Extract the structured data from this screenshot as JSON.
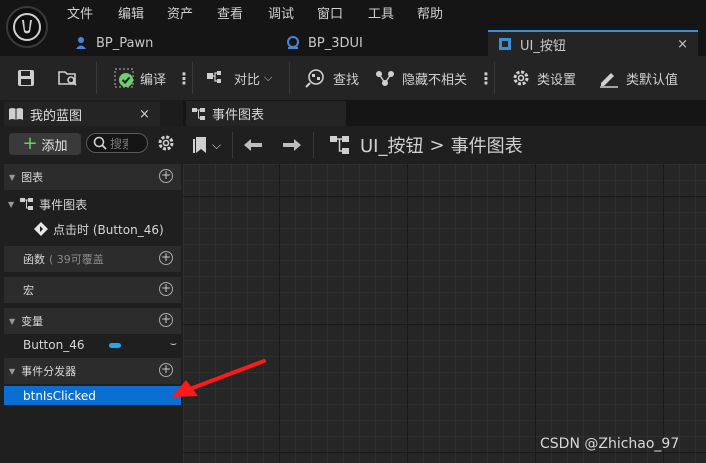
{
  "menu": [
    "文件",
    "编辑",
    "资产",
    "查看",
    "调试",
    "窗口",
    "工具",
    "帮助"
  ],
  "tabs": [
    {
      "label": "BP_Pawn"
    },
    {
      "label": "BP_3DUI"
    },
    {
      "label": "UI_按钮",
      "close": "×"
    }
  ],
  "toolbar": {
    "compile_label": "编译",
    "diff_label": "对比",
    "find_label": "查找",
    "hide_label": "隐藏不相关",
    "class_settings_label": "类设置",
    "class_defaults_label": "类默认值"
  },
  "my_blueprint": {
    "tab_label": "我的蓝图",
    "close": "×",
    "add_label": "添加",
    "search_placeholder": "搜索",
    "sections": {
      "graphs": {
        "label": "图表"
      },
      "event_graph": {
        "label": "事件图表"
      },
      "event_node": {
        "label": "点击时 (Button_46)"
      },
      "functions": {
        "label": "函数",
        "hint": "( 39可覆盖"
      },
      "macros": {
        "label": "宏"
      },
      "variables": {
        "label": "变量"
      },
      "variable_item": {
        "label": "Button_46"
      },
      "dispatchers": {
        "label": "事件分发器"
      },
      "dispatcher_item": {
        "label": "btnIsClicked"
      }
    }
  },
  "graph": {
    "tab_label": "事件图表",
    "breadcrumb_root": "UI_按钮",
    "breadcrumb_sep": ">",
    "breadcrumb_current": "事件图表"
  },
  "watermark": "CSDN @Zhichao_97",
  "colors": {
    "accent": "#0a6fd1",
    "compile_ok": "#6bd06b",
    "variable_pill": "#1ea7ff",
    "annotation_arrow": "#ff1a1a"
  }
}
